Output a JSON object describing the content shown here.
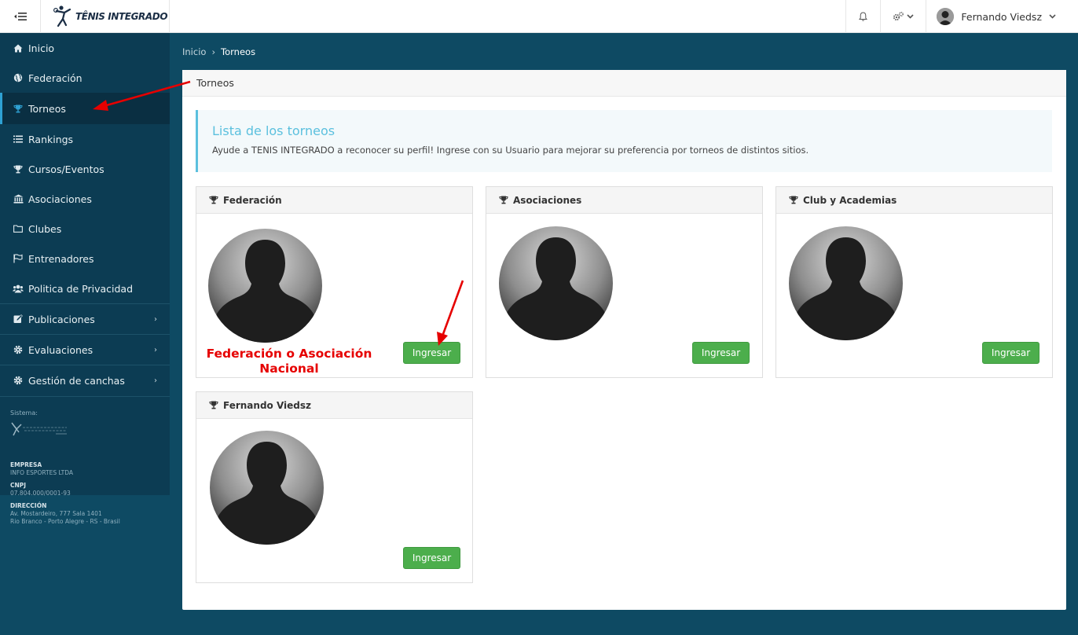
{
  "app": {
    "logo_text": "TÊNIS INTEGRADO"
  },
  "topbar": {
    "user_name": "Fernando Viedsz"
  },
  "sidebar": {
    "items": [
      {
        "label": "Inicio",
        "icon": "home-icon"
      },
      {
        "label": "Federación",
        "icon": "globe-icon"
      },
      {
        "label": "Torneos",
        "icon": "trophy-icon"
      },
      {
        "label": "Rankings",
        "icon": "list-icon"
      },
      {
        "label": "Cursos/Eventos",
        "icon": "trophy-icon"
      },
      {
        "label": "Asociaciones",
        "icon": "bank-icon"
      },
      {
        "label": "Clubes",
        "icon": "folder-icon"
      },
      {
        "label": "Entrenadores",
        "icon": "flag-icon"
      },
      {
        "label": "Politica de Privacidad",
        "icon": "users-icon"
      },
      {
        "label": "Publicaciones",
        "icon": "edit-icon"
      },
      {
        "label": "Evaluaciones",
        "icon": "gear-icon"
      },
      {
        "label": "Gestión de canchas",
        "icon": "gear-icon"
      }
    ],
    "system_label": "Sistema:",
    "company_heading": "EMPRESA",
    "company_name": "INFO ESPORTES LTDA",
    "cnpj_heading": "CNPJ",
    "cnpj_value": "07.804.000/0001-93",
    "address_heading": "DIRECCIÓN",
    "address_line1": "Av. Mostardeiro, 777 Sala 1401",
    "address_line2": "Rio Branco - Porto Alegre - RS - Brasil"
  },
  "breadcrumb": {
    "home": "Inicio",
    "separator": "›",
    "current": "Torneos"
  },
  "panel": {
    "title": "Torneos",
    "callout_title": "Lista de los torneos",
    "callout_text": "Ayude a TENIS INTEGRADO a reconocer su perfil! Ingrese con su Usuario para mejorar su preferencia por torneos de distintos sitios."
  },
  "cards": [
    {
      "title": "Federación",
      "button": "Ingresar"
    },
    {
      "title": "Asociaciones",
      "button": "Ingresar"
    },
    {
      "title": "Club y Academias",
      "button": "Ingresar"
    },
    {
      "title": "Fernando Viedsz",
      "button": "Ingresar"
    }
  ],
  "annotation": {
    "line1": "Federación o Asociación",
    "line2": "Nacional",
    "color": "#e60000"
  },
  "colors": {
    "sidebar": "#0c3c53",
    "accent": "#5bc0de",
    "button": "#4cae4c"
  }
}
